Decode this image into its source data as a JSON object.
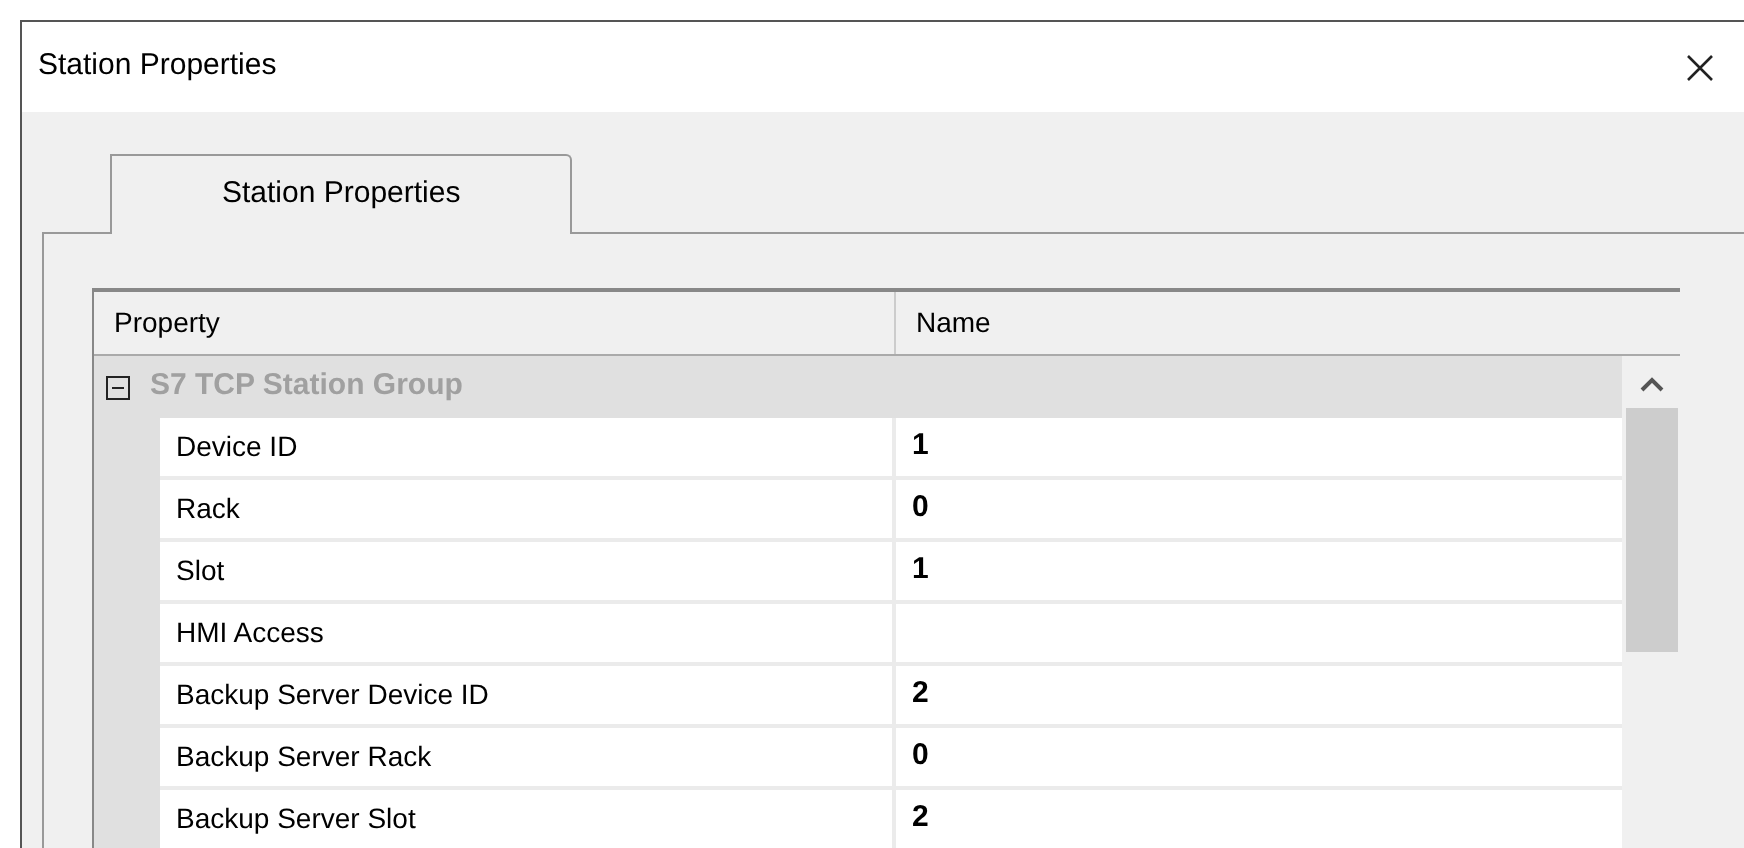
{
  "window": {
    "title": "Station Properties"
  },
  "tabs": [
    {
      "label": "Station Properties",
      "selected": true
    }
  ],
  "grid": {
    "columns": [
      "Property",
      "Name"
    ],
    "group": {
      "label": "S7 TCP Station Group",
      "expanded": true
    },
    "rows": [
      {
        "property": "Device ID",
        "value": "1"
      },
      {
        "property": "Rack",
        "value": "0"
      },
      {
        "property": "Slot",
        "value": "1"
      },
      {
        "property": "HMI Access",
        "value": ""
      },
      {
        "property": "Backup Server Device ID",
        "value": "2"
      },
      {
        "property": "Backup Server Rack",
        "value": "0"
      },
      {
        "property": "Backup Server Slot",
        "value": "2"
      }
    ]
  }
}
